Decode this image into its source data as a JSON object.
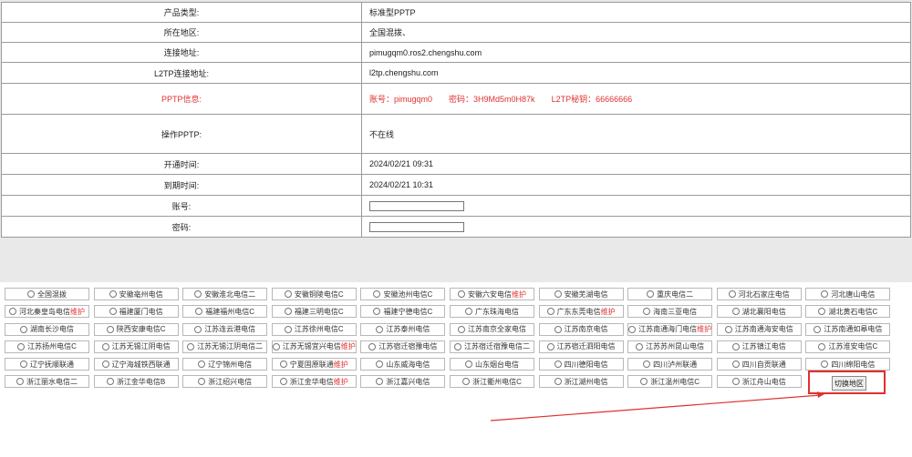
{
  "info_rows": [
    {
      "label": "产品类型:",
      "value": "标准型PPTP"
    },
    {
      "label": "所在地区:",
      "value": "全国混拨、"
    },
    {
      "label": "连接地址:",
      "value": "pimugqm0.ros2.chengshu.com"
    },
    {
      "label": "L2TP连接地址:",
      "value": "l2tp.chengshu.com"
    },
    {
      "label": "PPTP信息:",
      "pptp": {
        "account": "账号：pimugqm0",
        "password": "密码：3H9Md5m0H87k",
        "l2tp_key": "L2TP秘钥：66666666"
      }
    },
    {
      "label": "操作PPTP:",
      "value": "不在线"
    },
    {
      "label": "开通时间:",
      "value": "2024/02/21 09:31"
    },
    {
      "label": "到期时间:",
      "value": "2024/02/21 10:31"
    },
    {
      "label": "账号:",
      "input": true
    },
    {
      "label": "密码:",
      "input": true
    }
  ],
  "regions": [
    [
      "全国混拨",
      "安徽亳州电信",
      "安徽淮北电信二",
      "安徽铜陵电信C",
      "安徽池州电信C",
      "安徽六安电信|维护",
      "安徽芜湖电信",
      "重庆电信二",
      "河北石家庄电信",
      "河北唐山电信"
    ],
    [
      "河北秦皇岛电信|维护",
      "福建厦门电信",
      "福建福州电信C",
      "福建三明电信C",
      "福建宁德电信C",
      "广东珠海电信",
      "广东东莞电信|维护",
      "海南三亚电信",
      "湖北襄阳电信",
      "湖北黄石电信C"
    ],
    [
      "湖南长沙电信",
      "陕西安康电信C",
      "江苏连云港电信",
      "江苏徐州电信C",
      "江苏泰州电信",
      "江苏南京全家电信",
      "江苏南京电信",
      "江苏南通海门电信|维护",
      "江苏南通海安电信",
      "江苏南通如皋电信"
    ],
    [
      "江苏扬州电信C",
      "江苏无锡江阴电信",
      "江苏无锡江阴电信二",
      "江苏无锡宜兴电信|维护",
      "江苏宿迁宿豫电信",
      "江苏宿迁宿豫电信二",
      "江苏宿迁泗阳电信",
      "江苏苏州昆山电信",
      "江苏镇江电信",
      "江苏淮安电信C"
    ],
    [
      "辽宁抚顺联通",
      "辽宁海城铁西联通",
      "辽宁锦州电信",
      "宁夏固原联通|维护",
      "山东威海电信",
      "山东烟台电信",
      "四川德阳电信",
      "四川泸州联通",
      "四川自贡联通",
      "四川绵阳电信"
    ],
    [
      "浙江丽水电信二",
      "浙江金华电信B",
      "浙江绍兴电信",
      "浙江金华电信|维护",
      "浙江嘉兴电信",
      "浙江衢州电信C",
      "浙江湖州电信",
      "浙江温州电信C",
      "浙江舟山电信"
    ]
  ],
  "switch_button": "切换地区",
  "colors": {
    "accent": "#e0302f",
    "border": "#9a9a9a"
  }
}
